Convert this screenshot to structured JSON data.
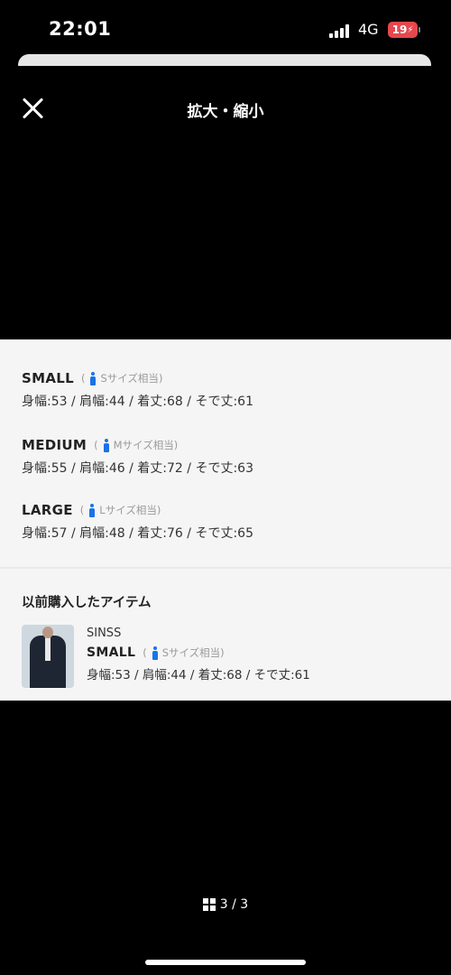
{
  "status_bar": {
    "time": "22:01",
    "network": "4G",
    "battery": "19"
  },
  "header": {
    "title": "拡大・縮小"
  },
  "sizes": [
    {
      "name": "SMALL",
      "equiv": "Sサイズ相当",
      "measure": "身幅:53 / 肩幅:44 / 着丈:68 / そで丈:61"
    },
    {
      "name": "MEDIUM",
      "equiv": "Mサイズ相当",
      "measure": "身幅:55 / 肩幅:46 / 着丈:72 / そで丈:63"
    },
    {
      "name": "LARGE",
      "equiv": "Lサイズ相当",
      "measure": "身幅:57 / 肩幅:48 / 着丈:76 / そで丈:65"
    }
  ],
  "previous": {
    "title": "以前購入したアイテム",
    "brand": "SINSS",
    "size": "SMALL",
    "equiv": "Sサイズ相当",
    "measure": "身幅:53 / 肩幅:44 / 着丈:68 / そで丈:61"
  },
  "pager": {
    "text": "3 / 3"
  },
  "accent_color": "#1a73e8"
}
